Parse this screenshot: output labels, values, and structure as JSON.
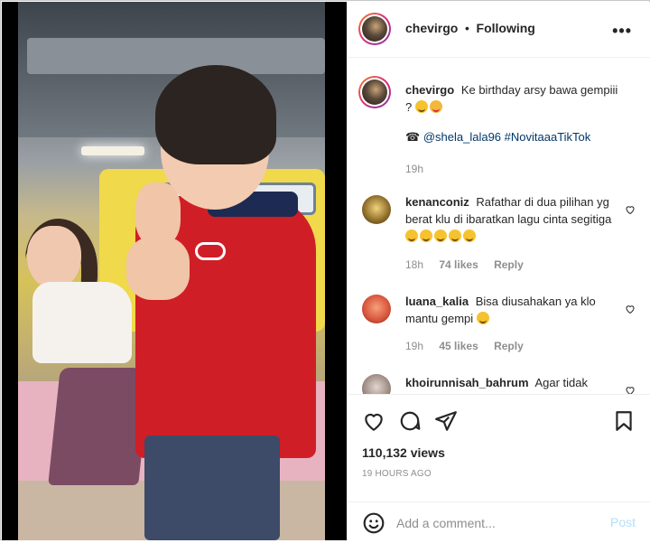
{
  "post": {
    "username": "chevirgo",
    "separator": "•",
    "following_label": "Following",
    "more_label": "•••",
    "caption_text": "Ke birthday arsy bawa gempiii ?",
    "caption_tags_icon": "☎",
    "caption_mention": "@shela_lala96",
    "caption_hashtag": "#NovitaaaTikTok",
    "caption_time": "19h"
  },
  "comments": [
    {
      "username": "kenanconiz",
      "text": "Rafathar di dua pilihan yg berat klu di ibaratkan lagu cinta segitiga",
      "time": "18h",
      "likes": "74 likes",
      "reply": "Reply"
    },
    {
      "username": "luana_kalia",
      "text": "Bisa diusahakan ya klo mantu gempi",
      "time": "19h",
      "likes": "45 likes",
      "reply": "Reply"
    },
    {
      "username": "khoirunnisah_bahrum",
      "text": "Agar tidak"
    }
  ],
  "stats": {
    "views": "110,132 views",
    "time_ago": "19 HOURS AGO"
  },
  "composer": {
    "placeholder": "Add a comment...",
    "post_label": "Post"
  },
  "icons": {
    "like": "heart-icon",
    "comment": "comment-icon",
    "share": "paper-plane-icon",
    "save": "bookmark-icon",
    "emoji": "smiley-icon",
    "more": "ellipsis-icon"
  },
  "colors": {
    "link": "#00376b",
    "muted": "#8e8e8e",
    "post_disabled": "#b2dffc",
    "shirt_red": "#d01e27"
  }
}
